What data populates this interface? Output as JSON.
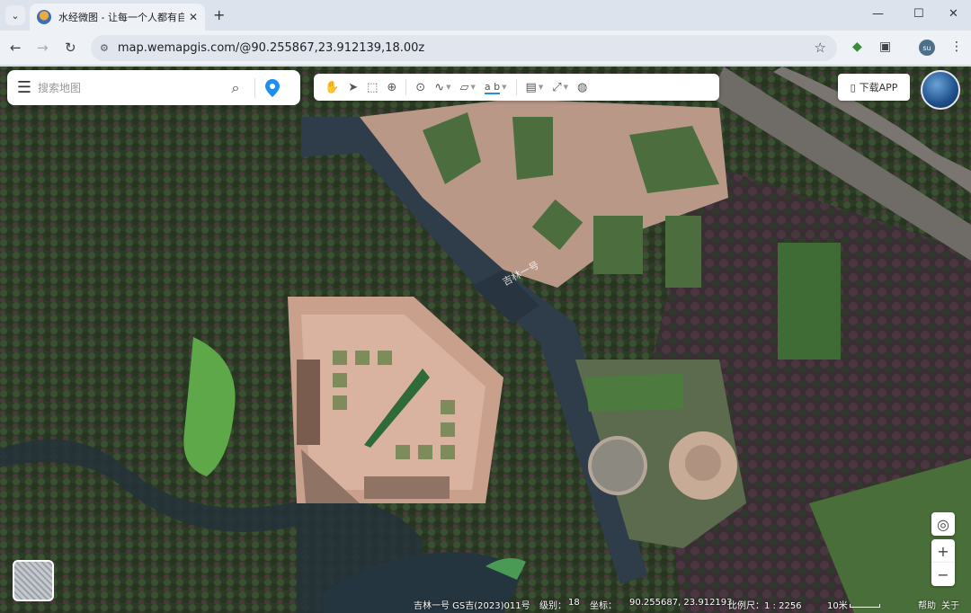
{
  "browser": {
    "tab_title": "水经微图 - 让每一个人都有自己",
    "url": "map.wemapgis.com/@90.255867,23.912139,18.00z",
    "profile_initials": "su"
  },
  "search": {
    "placeholder": "搜索地图"
  },
  "toolbar": {
    "items": [
      {
        "name": "pan",
        "icon": "hand-icon"
      },
      {
        "name": "select",
        "icon": "cursor-icon"
      },
      {
        "name": "box-select",
        "icon": "box-select-icon"
      },
      {
        "name": "zoom",
        "icon": "magnifier-icon"
      },
      {
        "name": "marker",
        "icon": "pin-icon"
      },
      {
        "name": "polyline",
        "icon": "polyline-icon",
        "dropdown": true
      },
      {
        "name": "polygon",
        "icon": "polygon-icon",
        "dropdown": true
      },
      {
        "name": "text",
        "icon": "text-ab-icon",
        "label": "a b",
        "dropdown": true
      },
      {
        "name": "measure",
        "icon": "ruler-icon",
        "dropdown": true
      },
      {
        "name": "edit",
        "icon": "edit-cursor-icon",
        "dropdown": true
      },
      {
        "name": "globe",
        "icon": "globe-icon"
      }
    ]
  },
  "download_app_label": "下载APP",
  "map_watermark": "吉林一号",
  "status": {
    "source": "吉林一号 GS吉(2023)011号",
    "level_label": "级别：",
    "level_value": "18",
    "coord_label": "坐标：",
    "coord_value": "90.255687, 23.912193",
    "scale_label": "比例尺：1 : 2256",
    "scale_bar_label": "10米",
    "help_link": "帮助",
    "about_link": "关于"
  },
  "colors": {
    "accent": "#1e8ef0",
    "moat": "#2e3a48",
    "lawn": "#3f6b34",
    "plaza": "#c8a08c"
  }
}
